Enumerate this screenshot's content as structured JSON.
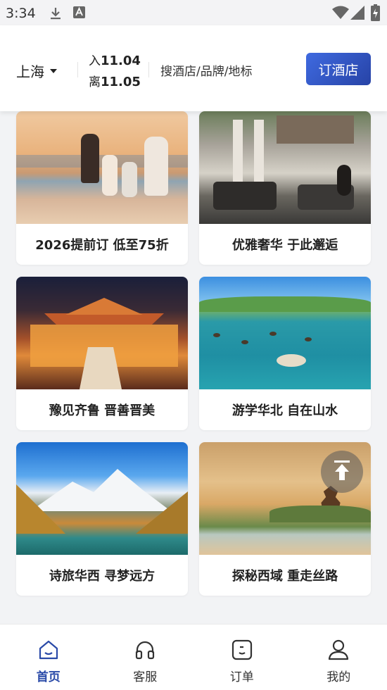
{
  "status_bar": {
    "time": "3:34",
    "icons": [
      "download-icon",
      "a-icon",
      "wifi-icon",
      "signal-icon",
      "battery-icon"
    ]
  },
  "header": {
    "city": "上海",
    "checkin_prefix": "入",
    "checkin_date": "11.04",
    "checkout_prefix": "离",
    "checkout_date": "11.05",
    "search_placeholder": "搜酒店/品牌/地标",
    "book_button": "订酒店"
  },
  "cards": [
    {
      "title": "2026提前订 低至75折",
      "image": "beach-family-sunset"
    },
    {
      "title": "优雅奢华  于此邂逅",
      "image": "hotel-lounge"
    },
    {
      "title": "豫见齐鲁  晋善晋美",
      "image": "night-palace"
    },
    {
      "title": "游学华北  自在山水",
      "image": "lake-ducks"
    },
    {
      "title": "诗旅华西  寻梦远方",
      "image": "snow-mountain"
    },
    {
      "title": "探秘西域  重走丝路",
      "image": "desert-pavilion"
    }
  ],
  "bottom_nav": [
    {
      "label": "首页",
      "icon": "home-icon",
      "active": true
    },
    {
      "label": "客服",
      "icon": "headset-icon",
      "active": false
    },
    {
      "label": "订单",
      "icon": "order-icon",
      "active": false
    },
    {
      "label": "我的",
      "icon": "profile-icon",
      "active": false
    }
  ],
  "colors": {
    "accent": "#2a4aa8",
    "button_gradient_start": "#3f6ae0",
    "button_gradient_end": "#2743a6",
    "background": "#f2f3f5"
  }
}
